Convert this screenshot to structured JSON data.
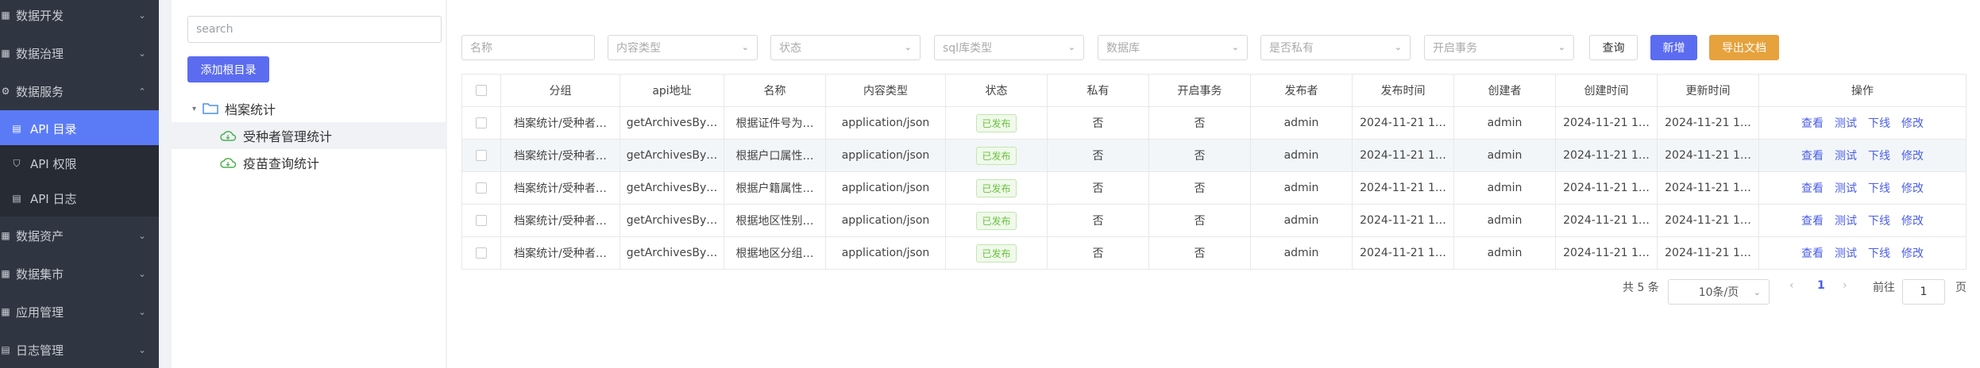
{
  "sidebar": {
    "items": [
      {
        "label": "数据开发",
        "chev": "⌄",
        "icon": "grid-icon"
      },
      {
        "label": "数据治理",
        "chev": "⌄",
        "icon": "grid-icon"
      },
      {
        "label": "数据服务",
        "chev": "⌃",
        "icon": "gear-icon"
      },
      {
        "label": "API 目录",
        "icon": "document-icon"
      },
      {
        "label": "API 权限",
        "icon": "shield-icon"
      },
      {
        "label": "API 日志",
        "icon": "log-icon"
      },
      {
        "label": "数据资产",
        "chev": "⌄",
        "icon": "database-icon"
      },
      {
        "label": "数据集市",
        "chev": "⌄",
        "icon": "grid-icon"
      },
      {
        "label": "应用管理",
        "chev": "⌄",
        "icon": "grid-icon"
      },
      {
        "label": "日志管理",
        "chev": "⌄",
        "icon": "log-icon"
      }
    ]
  },
  "tree": {
    "search_placeholder": "search",
    "add_root": "添加根目录",
    "nodes": [
      "档案统计",
      "受种者管理统计",
      "疫苗查询统计"
    ]
  },
  "filters": {
    "name": "名称",
    "content_type": "内容类型",
    "status": "状态",
    "sql_type": "sql库类型",
    "database": "数据库",
    "private": "是否私有",
    "transaction": "开启事务"
  },
  "buttons": {
    "query": "查询",
    "add": "新增",
    "export": "导出文档"
  },
  "table": {
    "headers": [
      "分组",
      "api地址",
      "名称",
      "内容类型",
      "状态",
      "私有",
      "开启事务",
      "发布者",
      "发布时间",
      "创建者",
      "创建时间",
      "更新时间",
      "操作"
    ],
    "rows": [
      [
        "档案统计/受种者…",
        "getArchivesBy…",
        "根据证件号为…",
        "application/json",
        "已发布",
        "否",
        "否",
        "admin",
        "2024-11-21 1…",
        "admin",
        "2024-11-21 1…",
        "2024-11-21 1…"
      ],
      [
        "档案统计/受种者…",
        "getArchivesBy…",
        "根据户口属性…",
        "application/json",
        "已发布",
        "否",
        "否",
        "admin",
        "2024-11-21 1…",
        "admin",
        "2024-11-21 1…",
        "2024-11-21 1…"
      ],
      [
        "档案统计/受种者…",
        "getArchivesBy…",
        "根据户籍属性…",
        "application/json",
        "已发布",
        "否",
        "否",
        "admin",
        "2024-11-21 1…",
        "admin",
        "2024-11-21 1…",
        "2024-11-21 1…"
      ],
      [
        "档案统计/受种者…",
        "getArchivesBy…",
        "根据地区性别…",
        "application/json",
        "已发布",
        "否",
        "否",
        "admin",
        "2024-11-21 1…",
        "admin",
        "2024-11-21 1…",
        "2024-11-21 1…"
      ],
      [
        "档案统计/受种者…",
        "getArchivesBy…",
        "根据地区分组…",
        "application/json",
        "已发布",
        "否",
        "否",
        "admin",
        "2024-11-21 1…",
        "admin",
        "2024-11-21 1…",
        "2024-11-21 1…"
      ]
    ],
    "ops": [
      "查看",
      "测试",
      "下线",
      "修改"
    ]
  },
  "pagination": {
    "total": "共 5 条",
    "size": "10条/页",
    "prev": "‹",
    "page": "1",
    "next": "›",
    "goto": "前往",
    "jump": "1",
    "unit": "页"
  },
  "colors": {
    "accent": "#5b6cf0",
    "export": "#e6a23c",
    "sidebar": "#303641",
    "active": "#5b7bf6",
    "published": "#67c23a"
  }
}
